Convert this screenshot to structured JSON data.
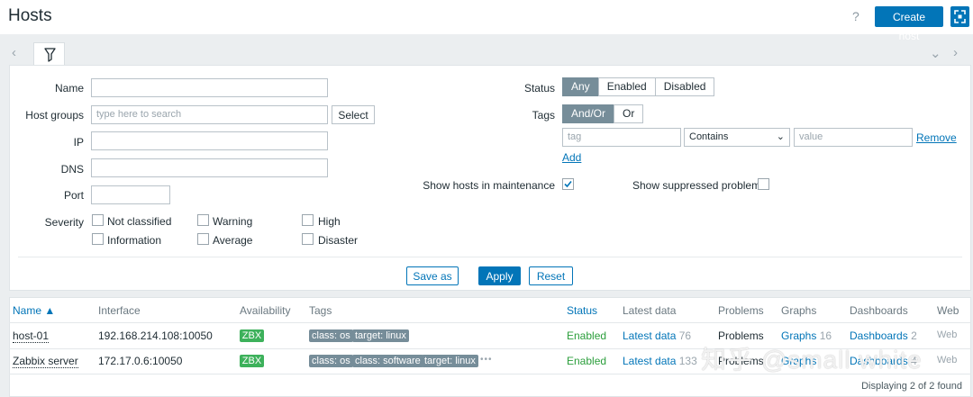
{
  "page": {
    "title": "Hosts",
    "help": "?",
    "create_host": "Create host"
  },
  "filter": {
    "name_label": "Name",
    "host_groups_label": "Host groups",
    "host_groups_placeholder": "type here to search",
    "select_label": "Select",
    "ip_label": "IP",
    "dns_label": "DNS",
    "port_label": "Port",
    "severity_label": "Severity",
    "severities": [
      "Not classified",
      "Warning",
      "High",
      "Information",
      "Average",
      "Disaster"
    ],
    "status_label": "Status",
    "status_options": [
      "Any",
      "Enabled",
      "Disabled"
    ],
    "status_selected": "Any",
    "tags_label": "Tags",
    "tags_options": [
      "And/Or",
      "Or"
    ],
    "tag_placeholder": "tag",
    "tag_operator": "Contains",
    "value_placeholder": "value",
    "remove_label": "Remove",
    "add_label": "Add",
    "show_maintenance_label": "Show hosts in maintenance",
    "show_maintenance_checked": true,
    "show_suppressed_label": "Show suppressed problems",
    "show_suppressed_checked": false,
    "save_as": "Save as",
    "apply": "Apply",
    "reset": "Reset"
  },
  "table": {
    "columns": [
      "Name ▲",
      "Interface",
      "Availability",
      "Tags",
      "Status",
      "Latest data",
      "Problems",
      "Graphs",
      "Dashboards",
      "Web"
    ],
    "rows": [
      {
        "name": "host-01",
        "interface": "192.168.214.108:10050",
        "availability": "ZBX",
        "tags": [
          "class: os",
          "target: linux"
        ],
        "more": "",
        "status": "Enabled",
        "latest_data": "Latest data",
        "latest_count": "76",
        "problems": "Problems",
        "graphs": "Graphs",
        "graphs_count": "16",
        "dashboards": "Dashboards",
        "dashboards_count": "2",
        "web": "Web"
      },
      {
        "name": "Zabbix server",
        "interface": "172.17.0.6:10050",
        "availability": "ZBX",
        "tags": [
          "class: os",
          "class: software",
          "target: linux"
        ],
        "more": "•••",
        "status": "Enabled",
        "latest_data": "Latest data",
        "latest_count": "133",
        "problems": "Problems",
        "graphs": "Graphs",
        "graphs_count": "",
        "dashboards": "Dashboards",
        "dashboards_count": "4",
        "web": "Web"
      }
    ],
    "footer": "Displaying 2 of 2 found"
  },
  "watermark": "知乎 @small white",
  "colors": {
    "primary": "#0275b8",
    "tag": "#768d99",
    "available": "#3db15b",
    "enabled": "#2b9e3b"
  }
}
